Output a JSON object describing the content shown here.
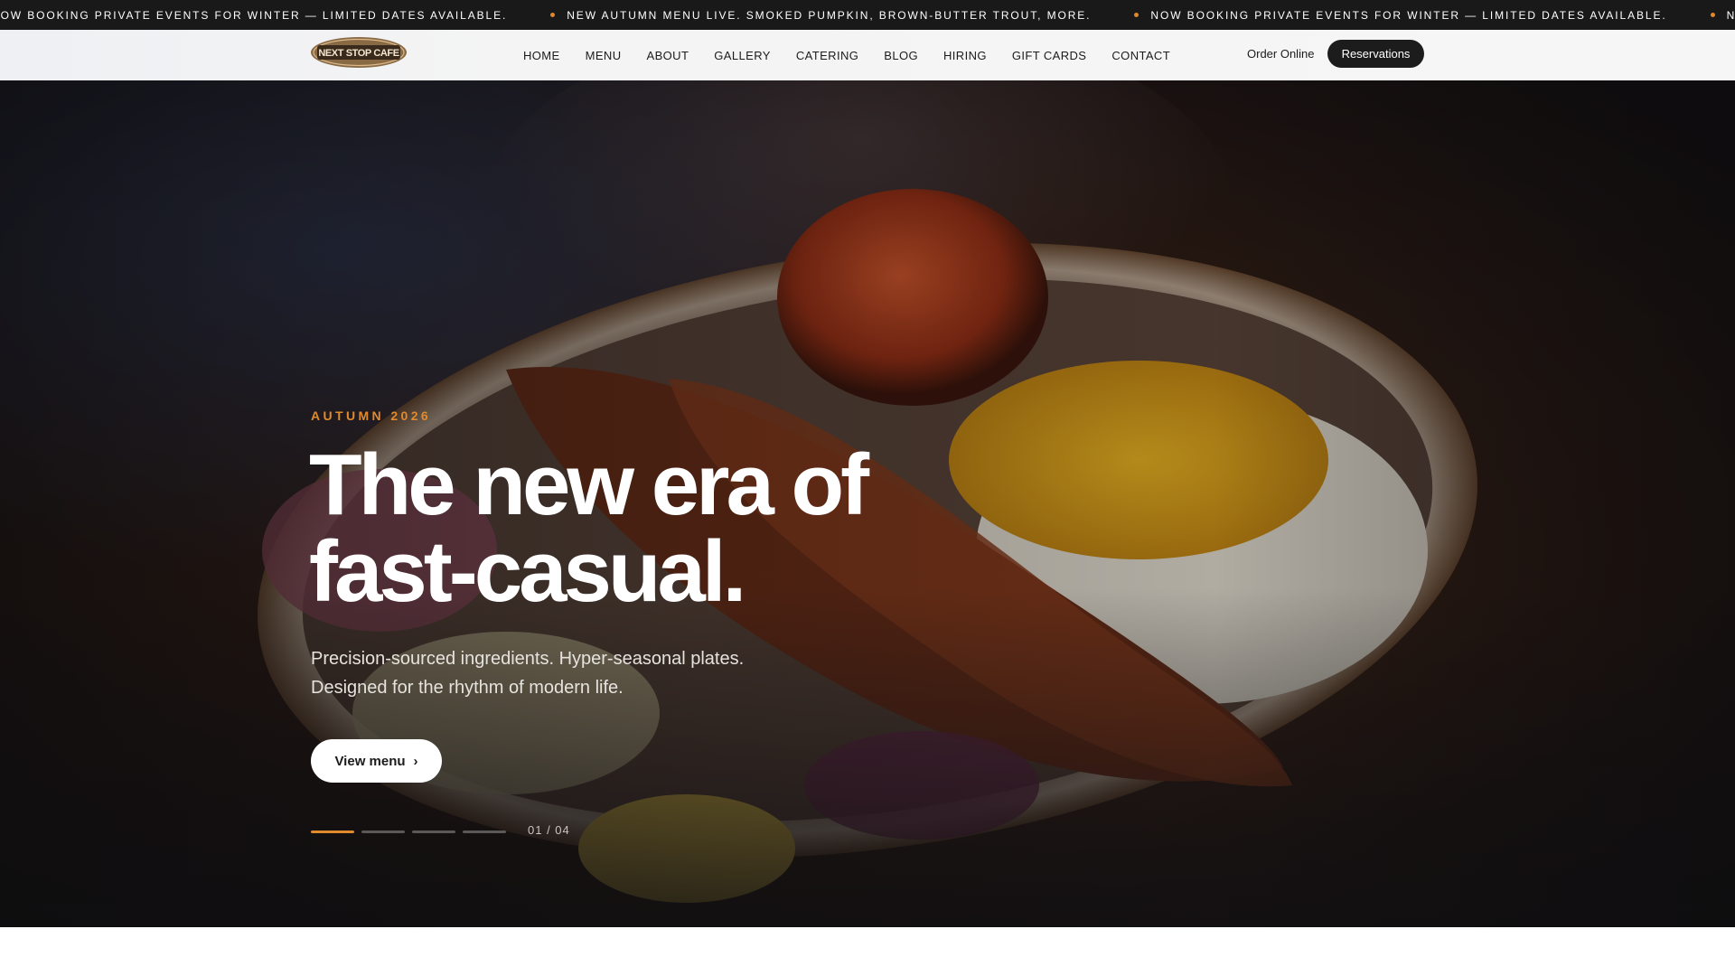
{
  "ticker": {
    "items": [
      "NOW BOOKING PRIVATE EVENTS FOR WINTER — LIMITED DATES AVAILABLE.",
      "NEW AUTUMN MENU LIVE. SMOKED PUMPKIN, BROWN-BUTTER TROUT, MORE.",
      "NOW BOOKING PRIVATE EVENTS FOR WINTER — LIMITED DATES AVAILABLE.",
      "NEW AUTUMN MENU LIVE. SMOKED PUMPKIN, BROWN-BUTTER TROUT, MORE."
    ],
    "dot_color": "#e0862b"
  },
  "header": {
    "logo_text": "NEXT STOP CAFE",
    "nav": [
      "HOME",
      "MENU",
      "ABOUT",
      "GALLERY",
      "CATERING",
      "BLOG",
      "HIRING",
      "GIFT CARDS",
      "CONTACT"
    ],
    "order_online": "Order Online",
    "reservations": "Reservations"
  },
  "hero": {
    "eyebrow": "AUTUMN 2026",
    "headline_line1": "The new era of",
    "headline_line2": "fast-casual.",
    "subtext_line1": "Precision-sourced ingredients. Hyper-seasonal plates.",
    "subtext_line2": "Designed for the rhythm of modern life.",
    "cta_label": "View menu",
    "cta_icon": "chevron-right-icon",
    "slide_counter": "01 / 04",
    "slides_total": 4,
    "active_slide": 1,
    "accent_color": "#e08a2c"
  }
}
